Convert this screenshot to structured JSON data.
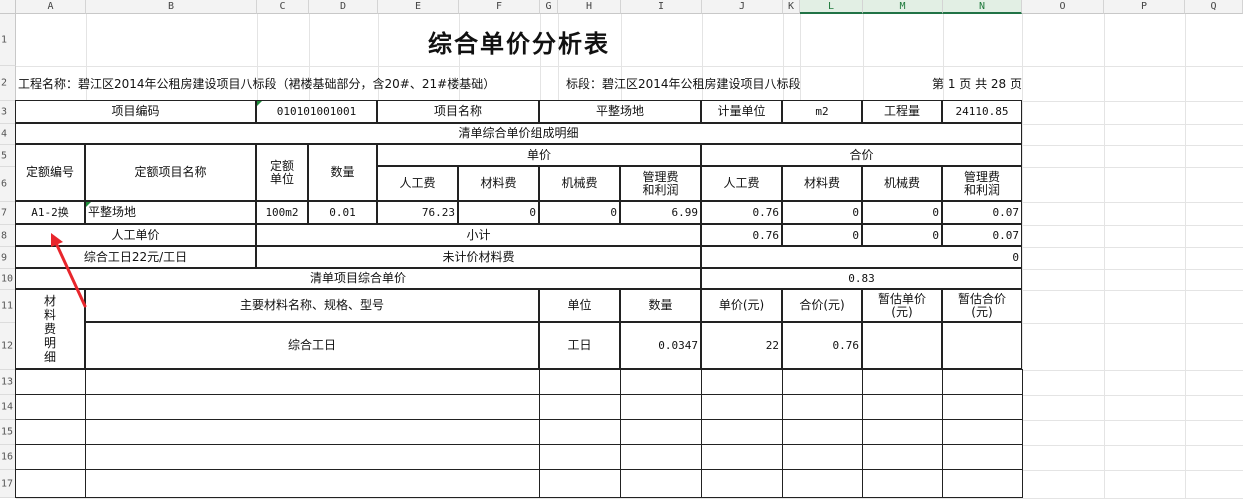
{
  "columns": [
    "A",
    "B",
    "C",
    "D",
    "E",
    "F",
    "G",
    "H",
    "I",
    "J",
    "K",
    "L",
    "M",
    "N",
    "O",
    "P",
    "Q"
  ],
  "rows": [
    "1",
    "2",
    "3",
    "4",
    "5",
    "6",
    "7",
    "8",
    "9",
    "10",
    "11",
    "12",
    "13",
    "14",
    "15",
    "16",
    "17"
  ],
  "sheet": {
    "title": "综合单价分析表",
    "project_name": "工程名称：碧江区2014年公租房建设项目八标段（裙楼基础部分，含20#、21#楼基础）",
    "section": "标段：碧江区2014年公租房建设项目八标段",
    "page_info": "第 1 页  共 28 页",
    "hdr_item_code_label": "项目编码",
    "item_code": "010101001001",
    "hdr_item_name_label": "项目名称",
    "item_name": "平整场地",
    "hdr_unit_label": "计量单位",
    "unit": "m2",
    "hdr_qty_label": "工程量",
    "qty": "24110.85",
    "detail_title": "清单综合单价组成明细",
    "quota_code_h": "定额编号",
    "quota_name_h": "定额项目名称",
    "quota_unit_h": "定额\n单位",
    "quantity_h": "数量",
    "unit_price_h": "单价",
    "total_price_h": "合价",
    "labor_h": "人工费",
    "material_h": "材料费",
    "machine_h": "机械费",
    "mgmt_h": "管理费\n和利润",
    "labor_h2": "人工费",
    "material_h2": "材料费",
    "machine_h2": "机械费",
    "mgmt_h2": "管理费\n和利润",
    "row7": {
      "code": "A1-2换",
      "name": "平整场地",
      "unit": "100m2",
      "qty": "0.01",
      "labor": "76.23",
      "material": "0",
      "machine": "0",
      "mgmt": "6.99",
      "labor_t": "0.76",
      "material_t": "0",
      "machine_t": "0",
      "mgmt_t": "0.07"
    },
    "labor_unit_price_label": "人工单价",
    "subtotal_label": "小计",
    "row8": {
      "labor_t": "0.76",
      "material_t": "0",
      "machine_t": "0",
      "mgmt_t": "0.07"
    },
    "wage_label": "综合工日22元/工日",
    "unpriced_label": "未计价材料费",
    "unpriced_value": "0",
    "item_total_label": "清单项目综合单价",
    "item_total_value": "0.83",
    "material_detail_label": "材\n料\n费\n明\n细",
    "mat_name_h": "主要材料名称、规格、型号",
    "mat_unit_h": "单位",
    "mat_qty_h": "数量",
    "mat_unit_price_h": "单价(元)",
    "mat_total_h": "合价(元)",
    "mat_est_unit_h": "暂估单价\n(元)",
    "mat_est_total_h": "暂估合价\n(元)",
    "row12": {
      "name": "综合工日",
      "unit": "工日",
      "qty": "0.0347",
      "unit_price": "22",
      "total": "0.76"
    }
  },
  "colors": {
    "accent": "#217346",
    "arrow": "#e8262c",
    "border": "#222222"
  }
}
